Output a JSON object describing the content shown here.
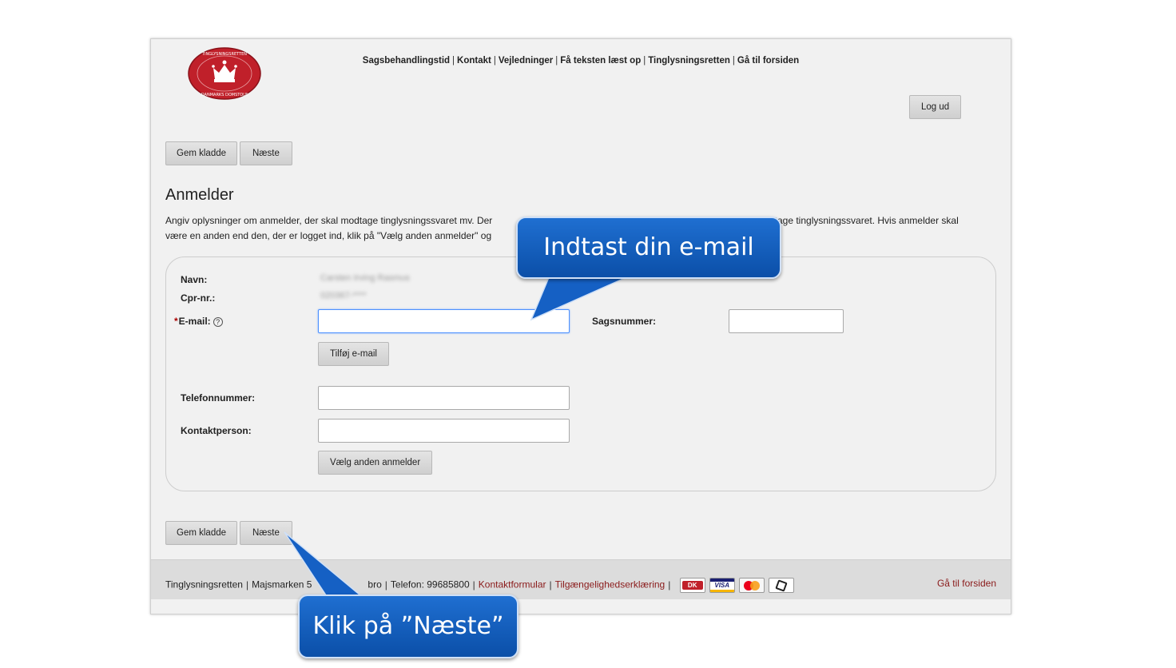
{
  "nav": {
    "items": [
      "Sagsbehandlingstid",
      "Kontakt",
      "Vejledninger",
      "Få teksten læst op",
      "Tinglysningsretten",
      "Gå til forsiden"
    ]
  },
  "logo": {
    "top_text": "TINGLYSNINGSRETTEN",
    "bottom_text": "DANMARKS DOMSTOLE"
  },
  "header": {
    "logout_label": "Log ud"
  },
  "toolbar": {
    "save_draft_label": "Gem kladde",
    "next_label": "Næste"
  },
  "page": {
    "title": "Anmelder",
    "intro_line1": "Angiv oplysninger om anmelder, der skal modtage tinglysningssvaret mv. Der",
    "intro_line1_end": "modtage tinglysningssvaret. Hvis anmelder skal",
    "intro_line2": "være en anden end den, der er logget ind, klik på \"Vælg anden anmelder\" og"
  },
  "form": {
    "name_label": "Navn:",
    "name_value": "Carsten Irving Rasmus",
    "cpr_label": "Cpr-nr.:",
    "cpr_value": "020367-****",
    "email_required_mark": "*",
    "email_label": "E-mail:",
    "email_help": "?",
    "email_value": "",
    "case_label": "Sagsnummer:",
    "case_value": "",
    "add_email_label": "Tilføj e-mail",
    "phone_label": "Telefonnummer:",
    "phone_value": "",
    "contact_label": "Kontaktperson:",
    "contact_value": "",
    "choose_other_label": "Vælg anden anmelder"
  },
  "footer": {
    "org": "Tinglysningsretten",
    "address": "Majsmarken 5",
    "city": "bro",
    "phone": "Telefon: 99685800",
    "contact_form": "Kontaktformular",
    "accessibility": "Tilgængelighedserklæring",
    "card_dk": "DK",
    "card_visa": "VISA",
    "home_link": "Gå til forsiden"
  },
  "callouts": {
    "email_hint": "Indtast din e-mail",
    "next_hint": "Klik på ”Næste”"
  },
  "colors": {
    "accent_blue": "#1560c4",
    "logo_red": "#c0202a",
    "link_red": "#8a1a1a"
  }
}
